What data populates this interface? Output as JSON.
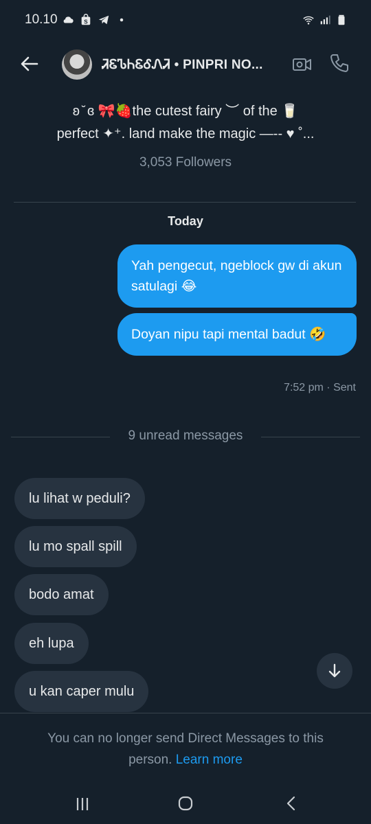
{
  "status_bar": {
    "time": "10.10",
    "left_icons": [
      "cloud-icon",
      "shop-icon",
      "telegram-icon",
      "dot-icon"
    ],
    "right_icons": [
      "wifi-icon",
      "signal-icon",
      "battery-icon"
    ]
  },
  "header": {
    "title": "ᏘᏋᏖᏂᏋᎴᏁᏘ • PINPRI NO...",
    "icons": [
      "back-arrow-icon",
      "video-call-icon",
      "phone-icon"
    ]
  },
  "profile": {
    "bio_line1": "ʚ ̆ ɞ 🎀🍓the cutest fairy ︶ of the 🥛",
    "bio_line2": "perfect ✦⁺. land make the magic —-- ♥ ˚...",
    "followers": "3,053 Followers"
  },
  "conversation": {
    "day_label": "Today",
    "sent_messages": [
      {
        "text": "Yah pengecut, ngeblock gw di akun satulagi 😂"
      },
      {
        "text": "Doyan nipu tapi mental badut 🤣"
      }
    ],
    "sent_meta": "7:52 pm · Sent",
    "unread_label": "9 unread messages",
    "received_messages": [
      {
        "text": "lu lihat w peduli?"
      },
      {
        "text": "lu mo spall spill"
      },
      {
        "text": "bodo amat"
      },
      {
        "text": "eh lupa"
      },
      {
        "text": "u kan caper mulu"
      }
    ]
  },
  "footer": {
    "notice": "You can no longer send Direct Messages to this person.",
    "link": "Learn more"
  },
  "colors": {
    "background": "#15202b",
    "accent": "#1d9bf0",
    "received_bubble": "#273340",
    "muted_text": "#8b98a5"
  }
}
